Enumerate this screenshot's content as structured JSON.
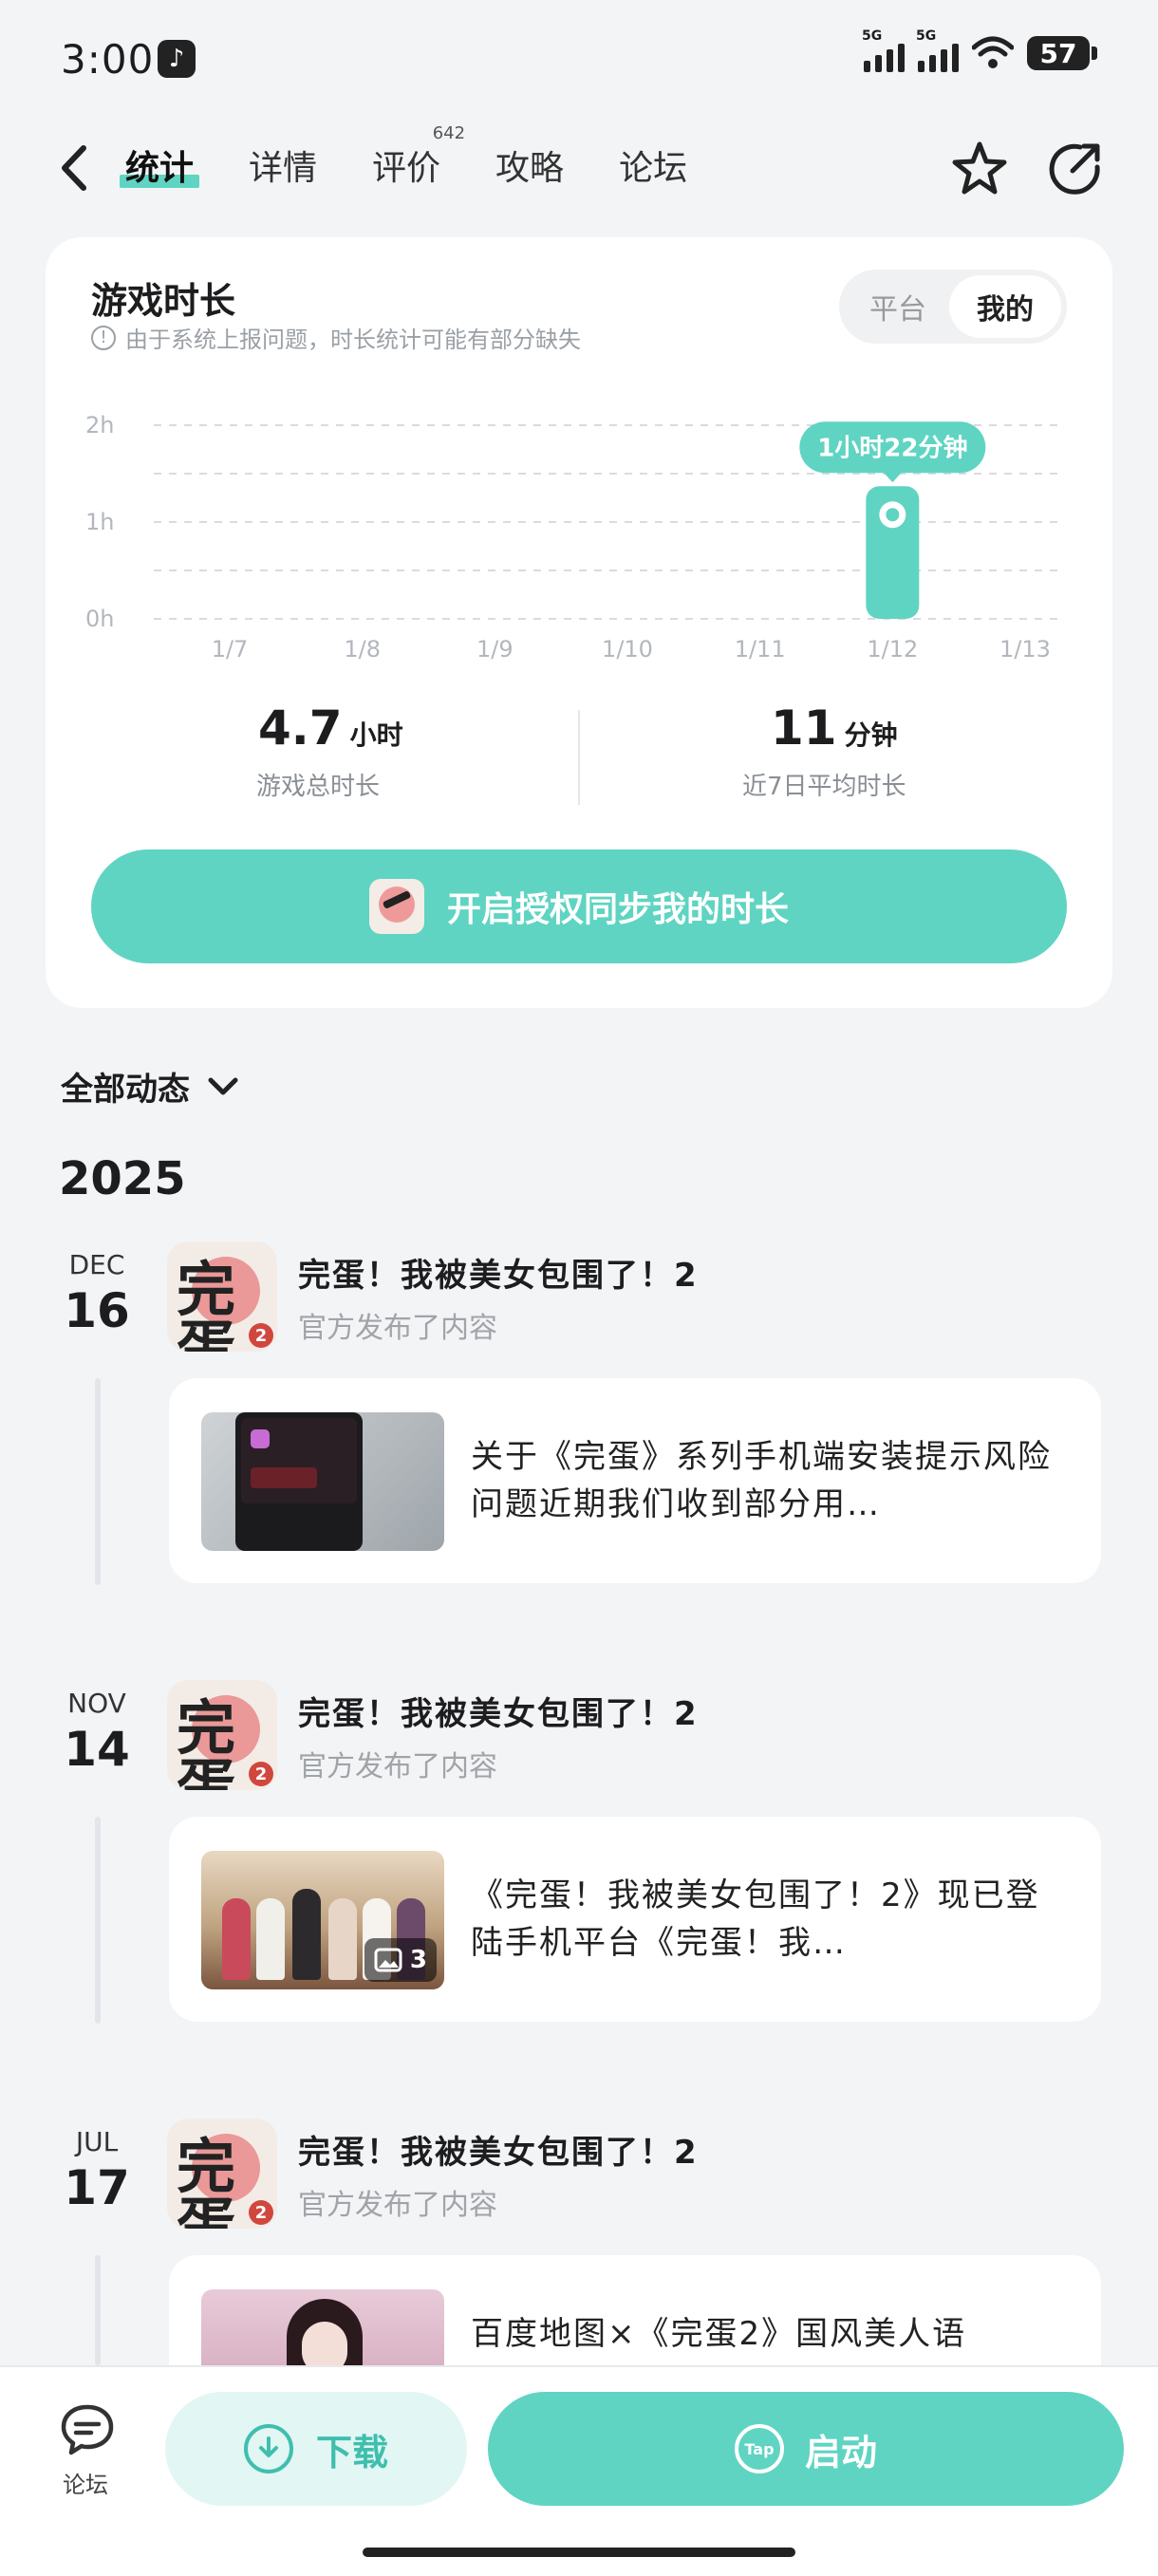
{
  "status_bar": {
    "time": "3:00",
    "network_1": "5G",
    "network_2": "5G",
    "battery": "57"
  },
  "tabs": [
    {
      "label": "统计",
      "active": true
    },
    {
      "label": "详情"
    },
    {
      "label": "评价",
      "badge": "642"
    },
    {
      "label": "攻略"
    },
    {
      "label": "论坛"
    }
  ],
  "playtime": {
    "title": "游戏时长",
    "note": "由于系统上报问题，时长统计可能有部分缺失",
    "toggle": {
      "platform": "平台",
      "mine": "我的",
      "selected": "mine"
    },
    "total_value": "4.7",
    "total_unit": "小时",
    "total_label": "游戏总时长",
    "avg_value": "11",
    "avg_unit": "分钟",
    "avg_label": "近7日平均时长",
    "auth_button": "开启授权同步我的时长"
  },
  "chart_data": {
    "type": "bar",
    "categories": [
      "1/7",
      "1/8",
      "1/9",
      "1/10",
      "1/11",
      "1/12",
      "1/13"
    ],
    "values": [
      0,
      0,
      0,
      0,
      0,
      1.37,
      0
    ],
    "y_ticks": [
      "2h",
      "1h",
      "0h"
    ],
    "ylim": [
      0,
      2
    ],
    "tooltip": {
      "category": "1/12",
      "label": "1小时22分钟"
    },
    "bar_color": "#5fd4c2"
  },
  "feed": {
    "filter_label": "全部动态",
    "year": "2025",
    "entries": [
      {
        "month": "DEC",
        "day": "16",
        "game": "完蛋！我被美女包围了！2",
        "sub": "官方发布了内容",
        "text": "关于《完蛋》系列手机端安装提示风险问题近期我们收到部分用…"
      },
      {
        "month": "NOV",
        "day": "14",
        "game": "完蛋！我被美女包围了！2",
        "sub": "官方发布了内容",
        "text": "《完蛋！我被美女包围了！2》现已登陆手机平台《完蛋！我…",
        "image_count": "3"
      },
      {
        "month": "JUL",
        "day": "17",
        "game": "完蛋！我被美女包围了！2",
        "sub": "官方发布了内容",
        "text": "百度地图×《完蛋2》国风美人语"
      }
    ]
  },
  "icon_glyph": "完蛋",
  "icon_badge": "2",
  "bottom": {
    "forum": "论坛",
    "download": "下载",
    "start": "启动",
    "tap_logo": "Tap"
  },
  "colors": {
    "accent": "#5fd4c2",
    "background": "#f3f4f6"
  }
}
